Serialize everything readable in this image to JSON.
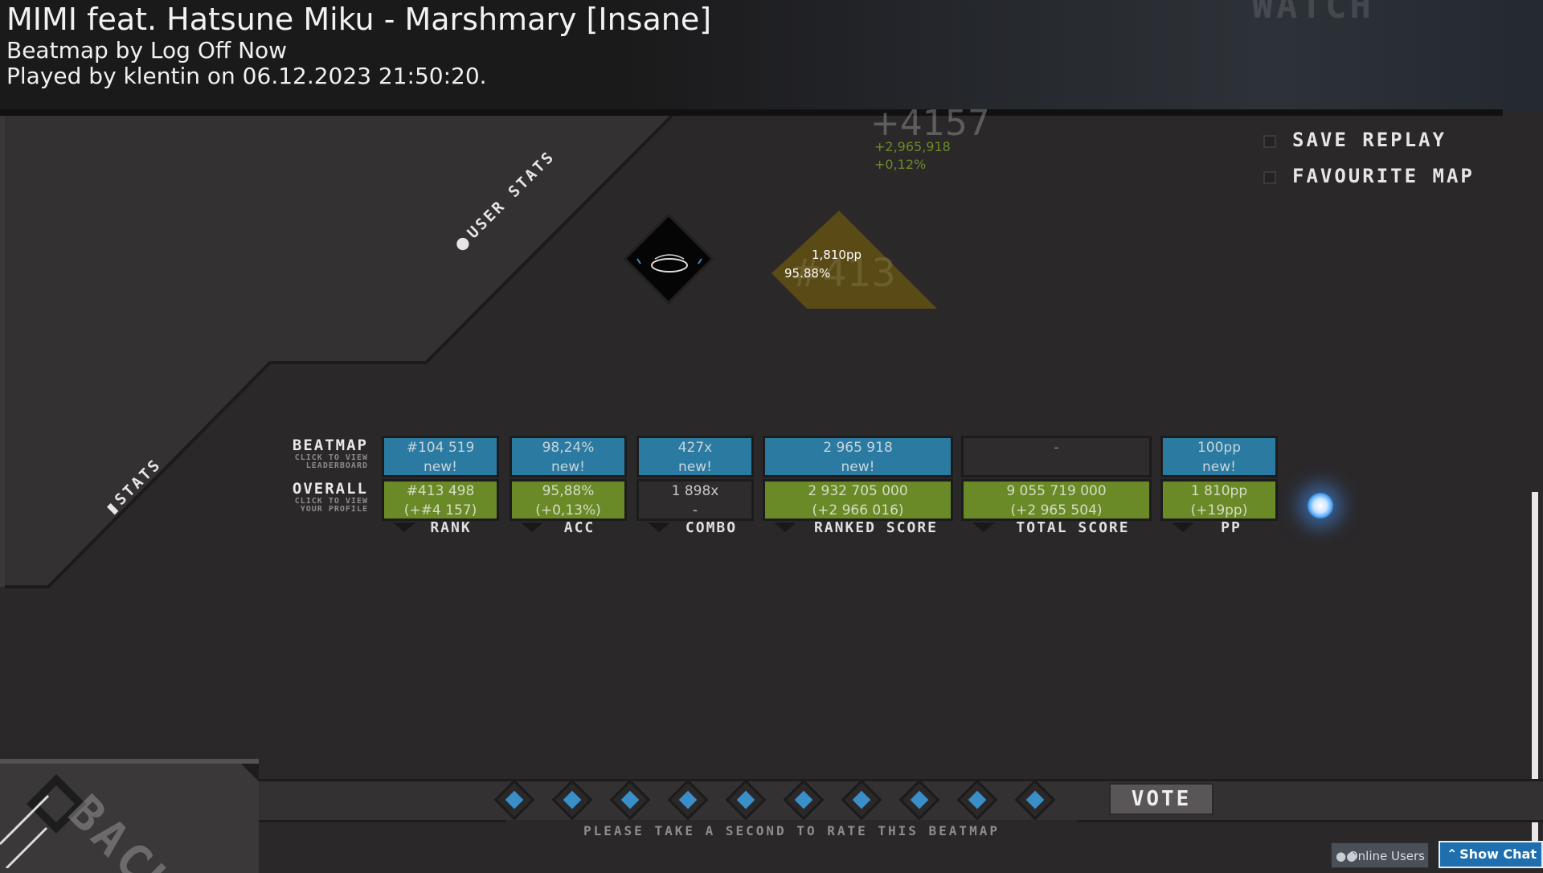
{
  "header": {
    "title": "MIMI feat. Hatsune Miku - Marshmary [Insane]",
    "beatmap_by": "Beatmap by Log Off Now",
    "played_by": "Played by klentin on 06.12.2023 21:50:20.",
    "watch_label": "WATCH"
  },
  "options": {
    "save_replay": "SAVE REPLAY",
    "favourite_map": "FAVOURITE MAP"
  },
  "tabs": {
    "user_stats": "USER STATS",
    "stats": "STATS"
  },
  "deltas": {
    "rank": "+4157",
    "score": "+2,965,918",
    "accuracy": "+0,12%"
  },
  "pp_badge": {
    "pp": "1,810pp",
    "accuracy": "95.88%",
    "rank_ghost": "#413"
  },
  "rows": {
    "beatmap": {
      "label": "BEATMAP",
      "sub1": "CLICK TO VIEW",
      "sub2": "LEADERBOARD"
    },
    "overall": {
      "label": "OVERALL",
      "sub1": "CLICK TO VIEW",
      "sub2": "YOUR PROFILE"
    }
  },
  "columns": [
    {
      "label": "RANK",
      "beatmap": [
        "#104 519",
        "new!"
      ],
      "overall": [
        "#413 498",
        "(+#4 157)"
      ]
    },
    {
      "label": "ACC",
      "beatmap": [
        "98,24%",
        "new!"
      ],
      "overall": [
        "95,88%",
        "(+0,13%)"
      ]
    },
    {
      "label": "COMBO",
      "beatmap": [
        "427x",
        "new!"
      ],
      "overall": [
        "1 898x",
        "-"
      ]
    },
    {
      "label": "RANKED SCORE",
      "beatmap": [
        "2 965 918",
        "new!"
      ],
      "overall": [
        "2 932 705 000",
        "(+2 966 016)"
      ]
    },
    {
      "label": "TOTAL SCORE",
      "beatmap": [
        "-",
        ""
      ],
      "overall": [
        "9 055 719 000",
        "(+2 965 504)"
      ]
    },
    {
      "label": "PP",
      "beatmap": [
        "100pp",
        "new!"
      ],
      "overall": [
        "1 810pp",
        "(+19pp)"
      ]
    }
  ],
  "rating": {
    "vote_label": "VOTE",
    "prompt": "PLEASE TAKE A SECOND TO RATE THIS BEATMAP",
    "star_count": 10
  },
  "back_label": "BACK",
  "footer": {
    "online_users": "Online Users",
    "show_chat": "Show Chat"
  },
  "colors": {
    "beatmap_cell": "#2b7aa1",
    "overall_cell": "#6a8a27",
    "background": "#2a2829",
    "accent_blue": "#3a8fc8"
  }
}
